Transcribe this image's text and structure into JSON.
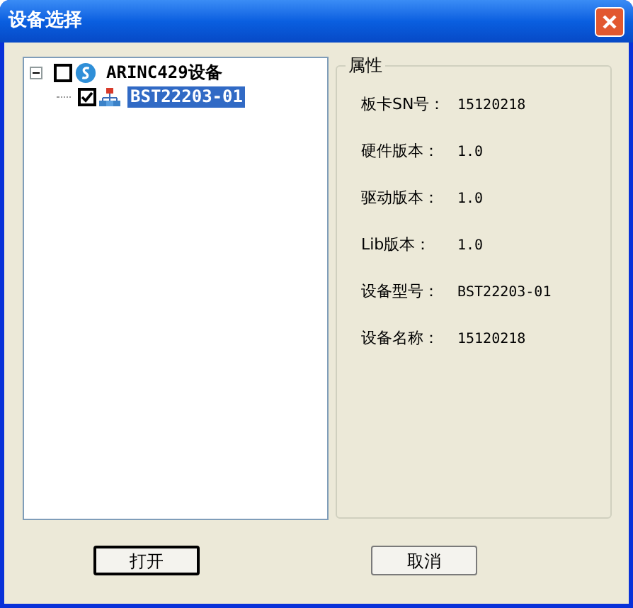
{
  "window": {
    "title": "设备选择"
  },
  "tree": [
    {
      "label": "ARINC429设备",
      "checked": false,
      "selected": false,
      "expanded": true,
      "kind": "category",
      "children": [
        {
          "label": "BST22203-01",
          "checked": true,
          "selected": true,
          "kind": "device"
        }
      ]
    }
  ],
  "properties": {
    "legend": "属性",
    "rows": [
      {
        "label": "板卡SN号：",
        "value": "15120218"
      },
      {
        "label": "硬件版本：",
        "value": "1.0"
      },
      {
        "label": "驱动版本：",
        "value": "1.0"
      },
      {
        "label": "Lib版本：",
        "value": "1.0"
      },
      {
        "label": "设备型号：",
        "value": "BST22203-01"
      },
      {
        "label": "设备名称：",
        "value": "15120218"
      }
    ]
  },
  "buttons": [
    {
      "label": "打开",
      "default": true
    },
    {
      "label": "取消",
      "default": false
    }
  ]
}
